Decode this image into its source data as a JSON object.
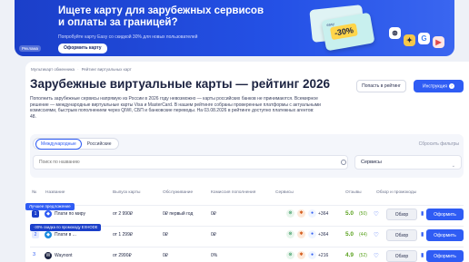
{
  "banner": {
    "title": "Ищете карту для зарубежных сервисов и оплаты за границей?",
    "subtitle": "Попробуйте карту Easy со скидкой 30% для новых пользователей",
    "cta_label": "Оформить карту",
    "ad_label": "Реклама",
    "card_discount": "-30%",
    "card_brand": "easy",
    "colors": {
      "bg": "#2451e6",
      "discount": "#ffd54a"
    }
  },
  "breadcrumbs": [
    "Мультикарт обменника",
    "Рейтинг виртуальных карт"
  ],
  "page_title": "Зарубежные виртуальные карты — рейтинг 2026",
  "intro": "Пополнить зарубежные сервисы напрямую из России в 2026 году невозможно — карты российских банков не принимаются. Всемирное решение — международные виртуальные карты Visa и MasterCard. В нашем рейтинге собраны проверенные платформы с актуальными комиссиями, быстрым пополнением через QIWI, СБП и банковские переводы. На 03.08.2026 в рейтинге доступно платежных агентов: 48.",
  "header_buttons": {
    "report": "Попасть в рейтинг",
    "guide": "Инструкция"
  },
  "filters": {
    "tabs": [
      {
        "label": "Международные",
        "active": true
      },
      {
        "label": "Российские",
        "active": false
      }
    ],
    "reset_label": "Сбросить фильтры",
    "search_placeholder": "Поиск по названию",
    "services_select": "Сервисы"
  },
  "table": {
    "columns": [
      "№",
      "Название",
      "Выпуск карты",
      "Обслуживание",
      "Комиссия пополнения",
      "Сервисы",
      "Отзывы",
      "Обзор и промокоды"
    ],
    "best_offer_tag": "Лучшее предложение",
    "promo_tag": "-30% скидка по промокоду EXHODE",
    "rows": [
      {
        "num": "1",
        "name": "Плати по миру",
        "issue": "от 2 990₽",
        "service": "0₽ первый год",
        "fee": "0₽",
        "more": "+364",
        "rating": "5.0",
        "rating_note": "(50)",
        "review": "Обзор",
        "order": "Оформить"
      },
      {
        "num": "2",
        "name": "Плати в ...",
        "issue": "от 1 299₽",
        "service": "0₽",
        "fee": "0₽",
        "more": "+364",
        "rating": "5.0",
        "rating_note": "(44)",
        "review": "Обзор",
        "order": "Оформить"
      },
      {
        "num": "3",
        "name": "Waynont",
        "issue": "от 2990₽",
        "service": "0₽",
        "fee": "0%",
        "more": "+216",
        "rating": "4.9",
        "rating_note": "(52)",
        "review": "Обзор",
        "order": "Оформить"
      }
    ]
  },
  "colors": {
    "primary": "#2f5cf4",
    "rating": "#5aa21f"
  }
}
